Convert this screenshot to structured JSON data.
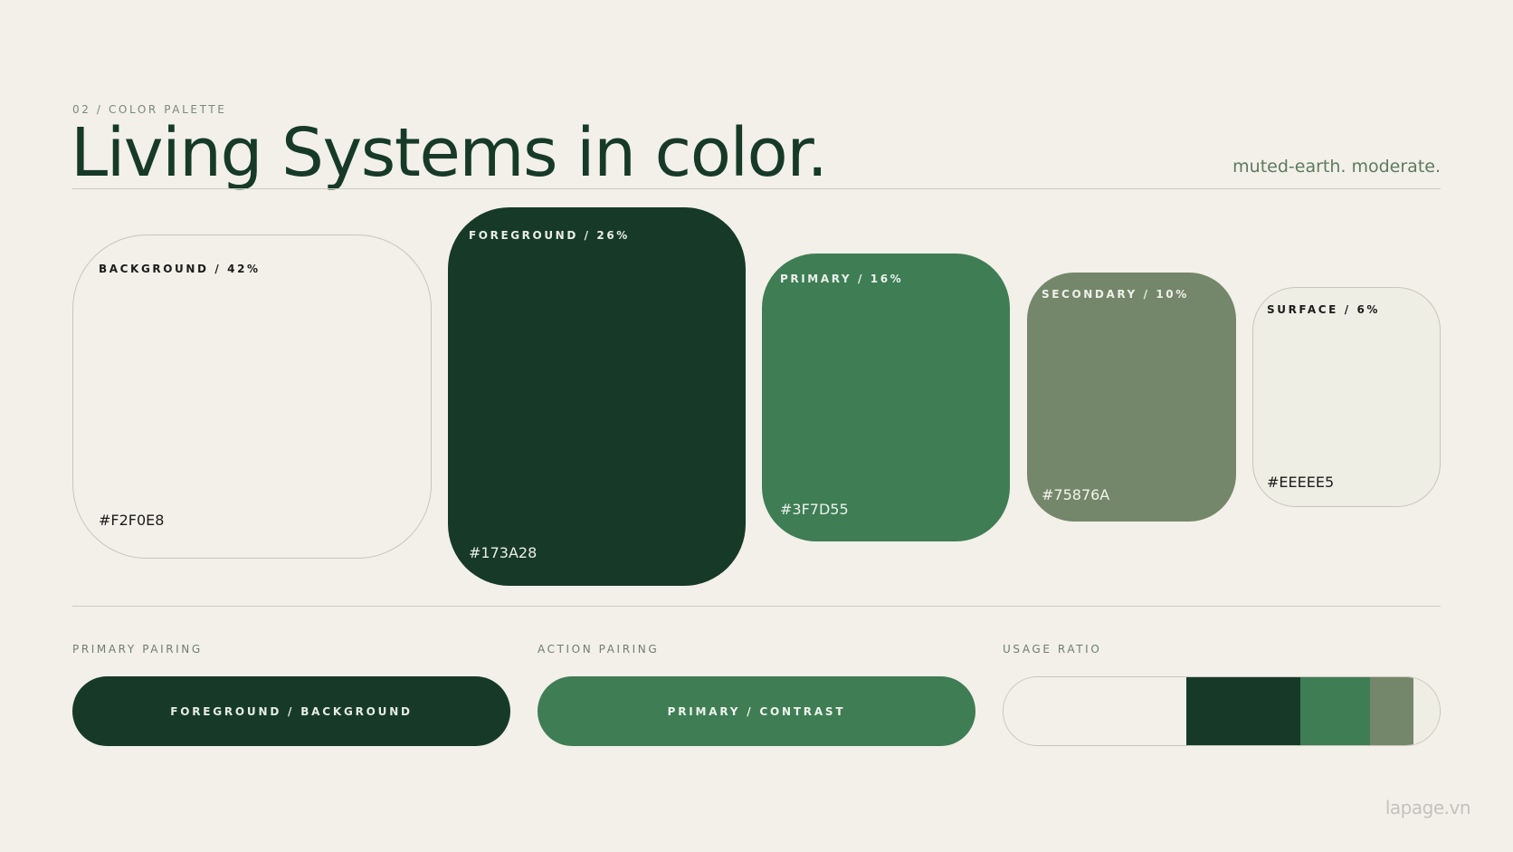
{
  "header": {
    "eyebrow": "02 / COLOR PALETTE",
    "title": "Living Systems in color.",
    "tagline": "muted-earth. moderate."
  },
  "swatches": [
    {
      "label": "BACKGROUND / 42%",
      "hex": "#F2F0E8",
      "color": "#F2F0E8",
      "share_percent": 42
    },
    {
      "label": "FOREGROUND / 26%",
      "hex": "#173A28",
      "color": "#173A28",
      "share_percent": 26
    },
    {
      "label": "PRIMARY / 16%",
      "hex": "#3F7D55",
      "color": "#3F7D55",
      "share_percent": 16
    },
    {
      "label": "SECONDARY / 10%",
      "hex": "#75876A",
      "color": "#75876A",
      "share_percent": 10
    },
    {
      "label": "SURFACE / 6%",
      "hex": "#EEEEE5",
      "color": "#EEEEE5",
      "share_percent": 6
    }
  ],
  "pairings": {
    "primary_label": "PRIMARY PAIRING",
    "primary_pill": "FOREGROUND / BACKGROUND",
    "action_label": "ACTION PAIRING",
    "action_pill": "PRIMARY / CONTRAST",
    "usage_label": "USAGE RATIO"
  },
  "usage_ratio": [
    {
      "name": "background",
      "percent": 42,
      "color": "#F2F0E8"
    },
    {
      "name": "foreground",
      "percent": 26,
      "color": "#173A28"
    },
    {
      "name": "primary",
      "percent": 16,
      "color": "#3F7D55"
    },
    {
      "name": "secondary",
      "percent": 10,
      "color": "#75876A"
    },
    {
      "name": "surface",
      "percent": 6,
      "color": "#EEEEE5"
    }
  ],
  "watermark": "lapage.vn"
}
